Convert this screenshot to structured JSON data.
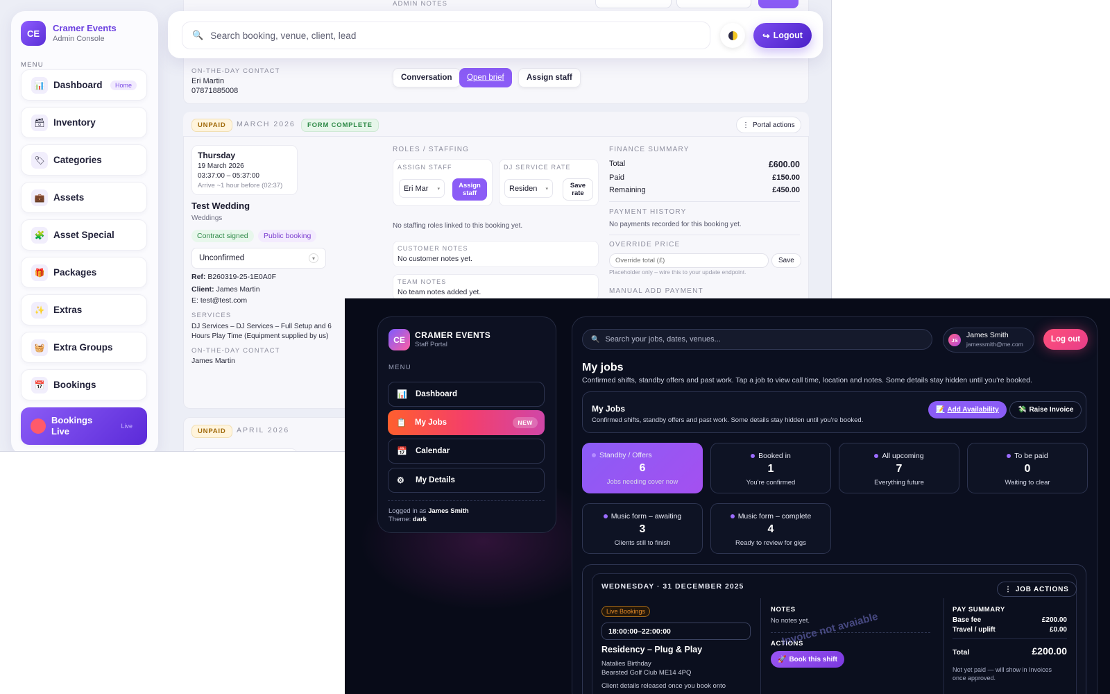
{
  "admin": {
    "brand": {
      "logo": "CE",
      "name": "Cramer Events",
      "subtitle": "Admin Console"
    },
    "menu_label": "MENU",
    "nav": [
      {
        "label": "Dashboard",
        "icon": "bar-chart-icon",
        "pill": "Home"
      },
      {
        "label": "Inventory",
        "icon": "box-icon"
      },
      {
        "label": "Categories",
        "icon": "tag-icon"
      },
      {
        "label": "Assets",
        "icon": "briefcase-icon"
      },
      {
        "label": "Asset Special",
        "icon": "puzzle-icon"
      },
      {
        "label": "Packages",
        "icon": "gift-icon"
      },
      {
        "label": "Extras",
        "icon": "sparkle-icon"
      },
      {
        "label": "Extra Groups",
        "icon": "basket-icon"
      },
      {
        "label": "Bookings",
        "icon": "calendar-icon"
      },
      {
        "label": "Bookings Live",
        "icon": "live-dot-icon",
        "pill": "Live"
      }
    ],
    "search_placeholder": "Search booking, venue, client, lead",
    "logout_label": "Logout",
    "prev_booking": {
      "contact_label": "ON-THE-DAY CONTACT",
      "contact_name": "Eri Martin",
      "contact_phone": "07871885008",
      "admin_notes_label": "ADMIN NOTES",
      "buttons": {
        "conversation": "Conversation",
        "open_brief": "Open brief",
        "assign_staff": "Assign staff"
      }
    },
    "booking": {
      "status_badge": "UNPAID",
      "month": "MARCH 2026",
      "form_badge": "FORM COMPLETE",
      "portal_actions": "Portal actions",
      "day": "Thursday",
      "date": "19 March 2026",
      "time": "03:37:00 – 05:37:00",
      "arrive": "Arrive ~1 hour before (02:37)",
      "title": "Test Wedding",
      "category": "Weddings",
      "tags": [
        "Contract signed",
        "Public booking"
      ],
      "status_select": "Unconfirmed",
      "ref_label": "Ref:",
      "ref": "B260319-25-1E0A0F",
      "client_label": "Client:",
      "client": "James Martin",
      "email": "E: test@test.com",
      "services_label": "SERVICES",
      "services": "DJ Services – DJ Services – Full Setup and 6 Hours Play Time (Equipment supplied by us)",
      "contact_label": "ON-THE-DAY CONTACT",
      "contact": "James Martin",
      "roles_label": "ROLES / STAFFING",
      "assign_staff_label": "ASSIGN STAFF",
      "assign_staff_value": "Eri Mar",
      "assign_staff_button": "Assign staff",
      "dj_rate_label": "DJ SERVICE RATE",
      "dj_rate_value": "Residen",
      "save_rate_button": "Save rate",
      "no_staffing": "No staffing roles linked to this booking yet.",
      "customer_notes_label": "CUSTOMER NOTES",
      "customer_notes": "No customer notes yet.",
      "team_notes_label": "TEAM NOTES",
      "team_notes": "No team notes added yet.",
      "finance_label": "FINANCE SUMMARY",
      "finance": [
        {
          "label": "Total",
          "value": "£600.00"
        },
        {
          "label": "Paid",
          "value": "£150.00"
        },
        {
          "label": "Remaining",
          "value": "£450.00"
        }
      ],
      "payment_history_label": "PAYMENT HISTORY",
      "payment_history": "No payments recorded for this booking yet.",
      "override_label": "OVERRIDE PRICE",
      "override_placeholder": "Override total (£)",
      "override_save": "Save",
      "override_hint": "Placeholder only – wire this to your update endpoint.",
      "manual_payment_label": "MANUAL ADD PAYMENT"
    },
    "next_booking": {
      "status_badge": "UNPAID",
      "month": "APRIL 2026"
    }
  },
  "staff": {
    "brand": {
      "logo": "CE",
      "name": "CRAMER EVENTS",
      "subtitle": "Staff Portal"
    },
    "menu_label": "MENU",
    "nav": [
      {
        "label": "Dashboard",
        "icon": "bar-chart-icon"
      },
      {
        "label": "My Jobs",
        "icon": "clipboard-icon",
        "badge": "NEW"
      },
      {
        "label": "Calendar",
        "icon": "calendar-icon"
      },
      {
        "label": "My Details",
        "icon": "gear-icon"
      }
    ],
    "logged_in_prefix": "Logged in as",
    "logged_in_user": "James Smith",
    "theme_prefix": "Theme:",
    "theme": "dark",
    "search_placeholder": "Search your jobs, dates, venues...",
    "user": {
      "initials": "JS",
      "name": "James Smith",
      "email": "jamessmith@me.com"
    },
    "logout_label": "Log out",
    "page_title": "My jobs",
    "page_subtitle": "Confirmed shifts, standby offers and past work. Tap a job to view call time, location and notes. Some details stay hidden until you're booked.",
    "panel_title": "My Jobs",
    "panel_subtitle": "Confirmed shifts, standby offers and past work. Some details stay hidden until you're booked.",
    "add_availability": "Add Availability",
    "raise_invoice": "Raise Invoice",
    "stats": [
      {
        "title": "Standby / Offers",
        "value": "6",
        "sub": "Jobs needing cover now"
      },
      {
        "title": "Booked in",
        "value": "1",
        "sub": "You're confirmed"
      },
      {
        "title": "All upcoming",
        "value": "7",
        "sub": "Everything future"
      },
      {
        "title": "To be paid",
        "value": "0",
        "sub": "Waiting to clear"
      },
      {
        "title": "Music form – awaiting",
        "value": "3",
        "sub": "Clients still to finish"
      },
      {
        "title": "Music form – complete",
        "value": "4",
        "sub": "Ready to review for gigs"
      }
    ],
    "job": {
      "date": "WEDNESDAY · 31 DECEMBER 2025",
      "actions_button": "JOB ACTIONS",
      "badge": "Live Bookings",
      "time": "18:00:00–22:00:00",
      "title": "Residency – Plug & Play",
      "event": "Natalies Birthday",
      "venue": "Bearsted Golf Club ME14 4PQ",
      "client_note": "Client details released once you book onto",
      "notes_label": "NOTES",
      "notes": "No notes yet.",
      "actions_label": "ACTIONS",
      "invoice_watermark": "Invoice not avaiable",
      "book_button": "Book this shift",
      "pay_label": "PAY SUMMARY",
      "pay": [
        {
          "label": "Base fee",
          "value": "£200.00"
        },
        {
          "label": "Travel / uplift",
          "value": "£0.00"
        }
      ],
      "total_label": "Total",
      "total": "£200.00",
      "pay_note": "Not yet paid — will show in Invoices once approved."
    }
  }
}
